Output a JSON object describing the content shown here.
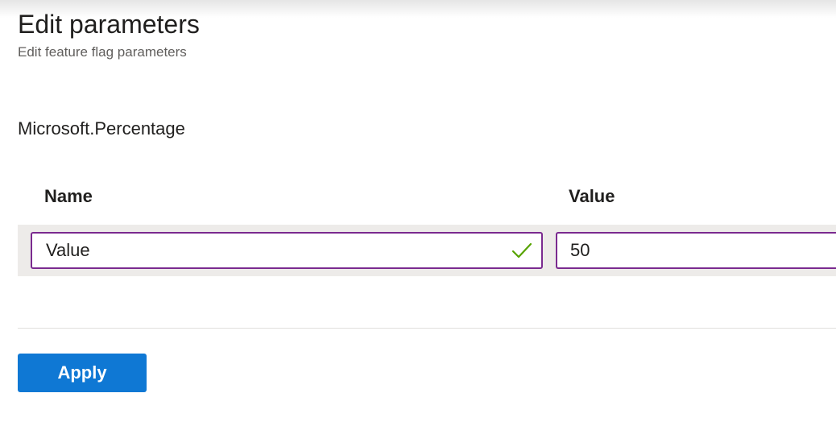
{
  "header": {
    "title": "Edit parameters",
    "subtitle": "Edit feature flag parameters"
  },
  "filter": {
    "name": "Microsoft.Percentage"
  },
  "grid": {
    "columns": [
      "Name",
      "Value"
    ],
    "rows": [
      {
        "name": "Value",
        "name_valid_icon": "checkmark-icon",
        "value": "50"
      }
    ]
  },
  "actions": {
    "apply_label": "Apply"
  },
  "colors": {
    "accent": "#0f78d4",
    "input_border_focus": "#7a2a8f",
    "valid_check": "#57a300",
    "row_background": "#edebe9"
  }
}
